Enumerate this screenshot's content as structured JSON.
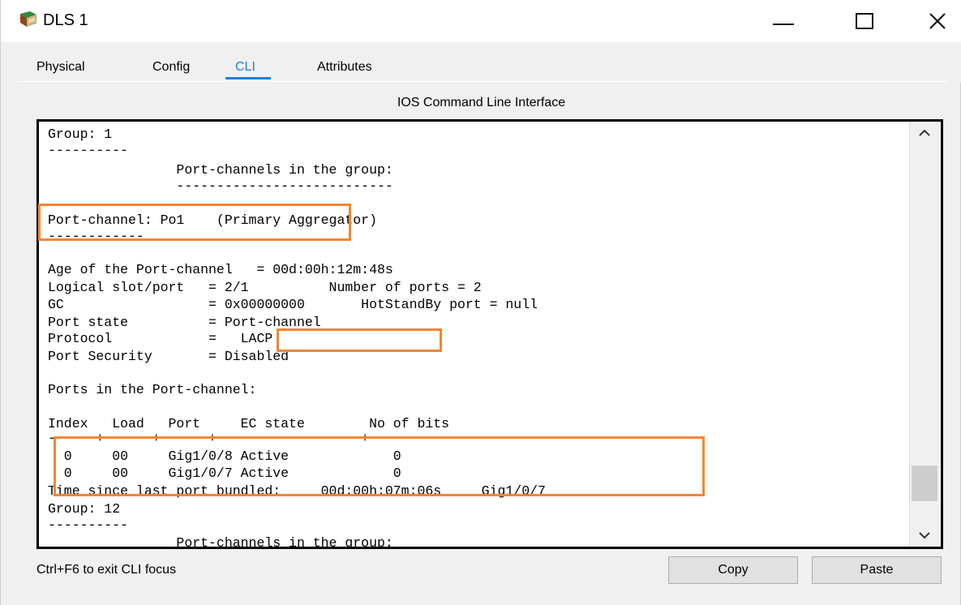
{
  "window": {
    "title": "DLS 1",
    "icon": "packet-tracer-switch-icon",
    "controls": [
      "minimize-icon",
      "maximize-icon",
      "close-icon"
    ]
  },
  "tabs": [
    {
      "label": "Physical",
      "active": false
    },
    {
      "label": "Config",
      "active": false
    },
    {
      "label": "CLI",
      "active": true
    },
    {
      "label": "Attributes",
      "active": false
    }
  ],
  "cli": {
    "heading": "IOS Command Line Interface",
    "lines": [
      "Group: 1",
      "----------",
      "                Port-channels in the group:",
      "                ---------------------------",
      "",
      "Port-channel: Po1    (Primary Aggregator)",
      "------------",
      "",
      "Age of the Port-channel   = 00d:00h:12m:48s",
      "Logical slot/port   = 2/1          Number of ports = 2",
      "GC                  = 0x00000000       HotStandBy port = null",
      "Port state          = Port-channel",
      "Protocol            =   LACP",
      "Port Security       = Disabled",
      "",
      "Ports in the Port-channel:",
      "",
      "Index   Load   Port     EC state        No of bits",
      "------+------+------+------------------+-----------",
      "  0     00     Gig1/0/8 Active             0",
      "  0     00     Gig1/0/7 Active             0",
      "Time since last port bundled:     00d:00h:07m:06s     Gig1/0/7",
      "Group: 12",
      "----------",
      "                Port-channels in the group:"
    ]
  },
  "status_text": "Ctrl+F6 to exit CLI focus",
  "buttons": {
    "copy": "Copy",
    "paste": "Paste"
  },
  "colors": {
    "accent": "#1e7fd8",
    "highlight": "#f48534"
  }
}
